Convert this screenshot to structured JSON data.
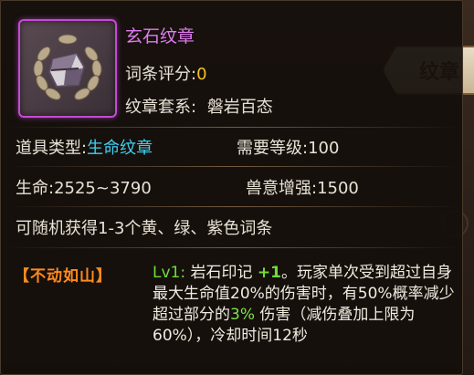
{
  "background": {
    "tab_label": "纹章"
  },
  "item": {
    "name": "玄石纹章",
    "name_color": "#e07cf0",
    "frame_color": "#c54ad6",
    "icon": "stone-emblem-icon",
    "rating_label": "词条评分:",
    "rating_value": "0",
    "set_label": "纹章套系:",
    "set_value": "磐岩百态"
  },
  "stats": {
    "type_label": "道具类型:",
    "type_value": "生命纹章",
    "level_label": "需要等级:",
    "level_value": "100",
    "hp_label": "生命:",
    "hp_value": "2525~3790",
    "beast_label": "兽意增强:",
    "beast_value": "1500"
  },
  "random_text": "可随机获得1-3个黄、绿、紫色词条",
  "skill": {
    "badge": "【不动如山】",
    "level": "Lv1:",
    "name": " 岩石印记 ",
    "plus": "+1",
    "text1": "。玩家单次受到超过自身最大生命值20%的伤害时，有50%概率减少超过部分的",
    "pct": "3%",
    "text2": " 伤害（减伤叠加上限为60%），冷却时间12秒"
  }
}
